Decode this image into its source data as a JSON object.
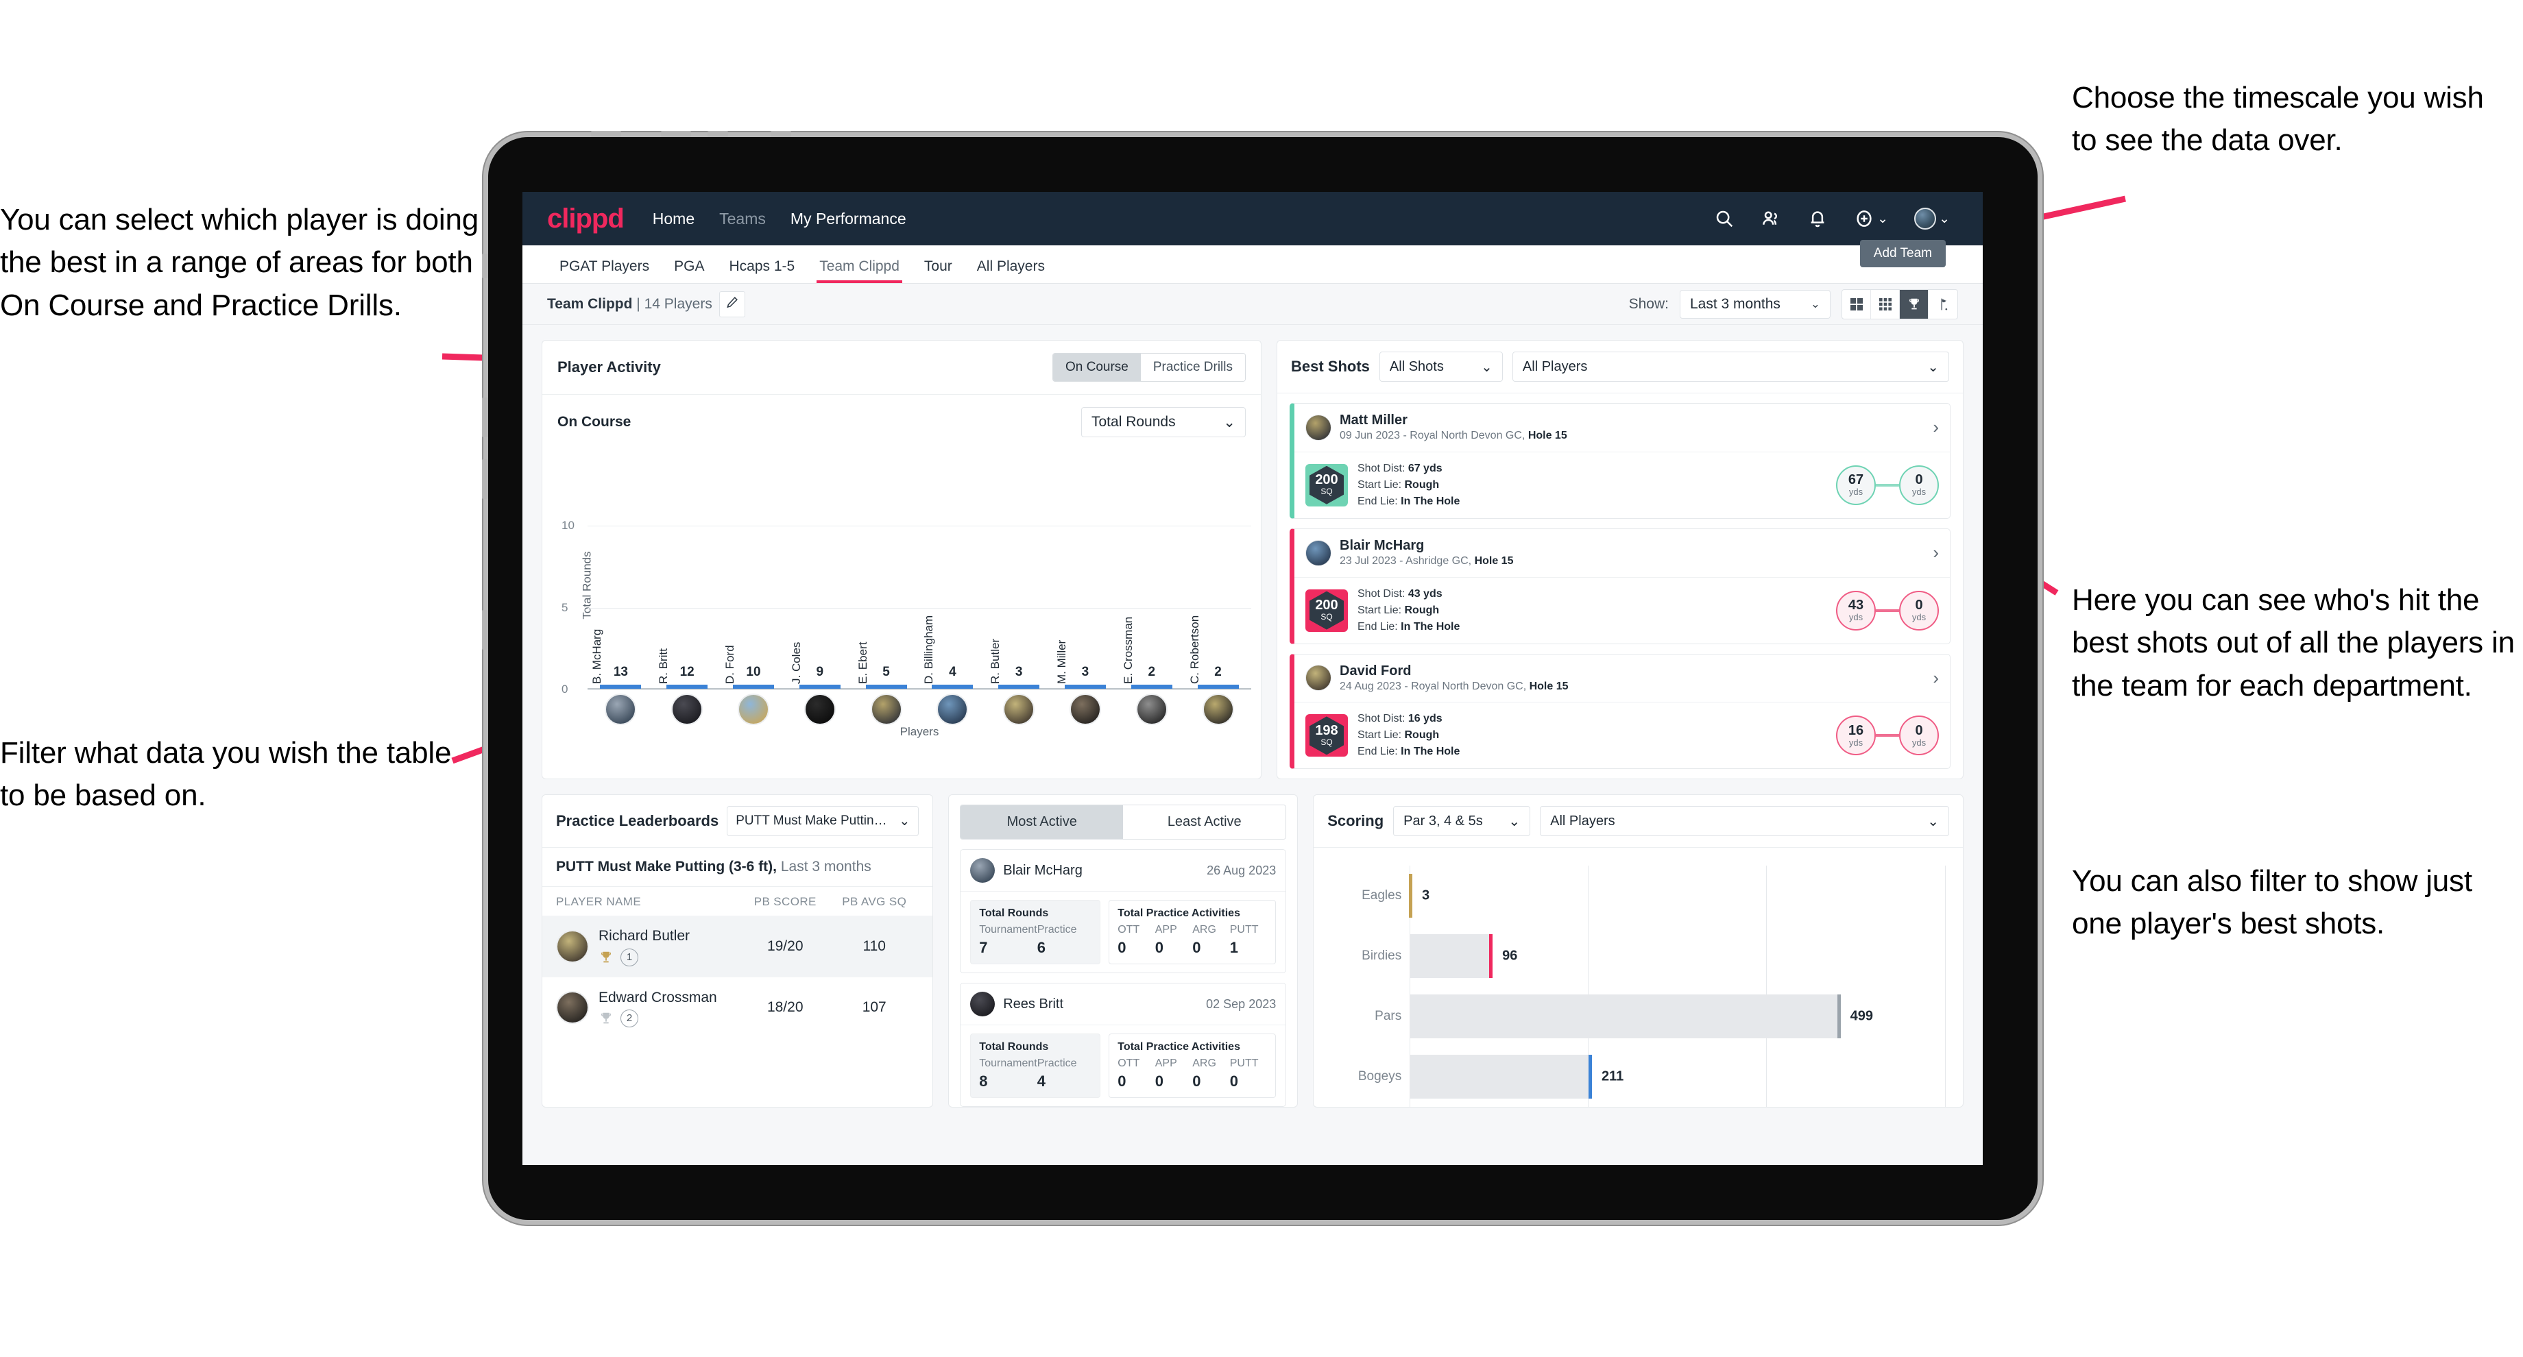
{
  "annotations": {
    "left_top": "You can select which player is doing the best in a range of areas for both On Course and Practice Drills.",
    "left_bottom": "Filter what data you wish the table to be based on.",
    "right_top": "Choose the timescale you wish to see the data over.",
    "right_middle": "Here you can see who's hit the best shots out of all the players in the team for each department.",
    "right_bottom": "You can also filter to show just one player's best shots."
  },
  "navbar": {
    "logo": "clippd",
    "links": [
      {
        "label": "Home",
        "active": true
      },
      {
        "label": "Teams",
        "active": false
      },
      {
        "label": "My Performance",
        "active": true
      }
    ],
    "icons": [
      "search-icon",
      "people-icon",
      "bell-icon",
      "plus-circle-icon",
      "avatar-icon"
    ]
  },
  "tabs": {
    "items": [
      "PGAT Players",
      "PGA",
      "Hcaps 1-5",
      "Team Clippd",
      "Tour",
      "All Players"
    ],
    "active": "Team Clippd",
    "tooltip": "Add Team"
  },
  "subheader": {
    "team_name": "Team Clippd",
    "player_count": "14 Players",
    "separator": "|",
    "edit_icon": "pencil-icon",
    "show_label": "Show:",
    "timescale": "Last 3 months",
    "view_icons": [
      "grid-large-icon",
      "grid-small-icon",
      "trophy-icon",
      "flag-icon"
    ],
    "active_view": "trophy-icon"
  },
  "player_activity": {
    "title": "Player Activity",
    "toggle": {
      "options": [
        "On Course",
        "Practice Drills"
      ],
      "selected": "On Course"
    },
    "subtitle": "On Course",
    "metric_select": "Total Rounds",
    "chart_data": {
      "type": "bar",
      "title": "On Course",
      "xlabel": "Players",
      "ylabel": "Total Rounds",
      "ylim": [
        0,
        14
      ],
      "yticks": [
        0,
        5,
        10
      ],
      "grid": true,
      "categories": [
        "B. McHarg",
        "R. Britt",
        "D. Ford",
        "J. Coles",
        "E. Ebert",
        "D. Billingham",
        "R. Butler",
        "M. Miller",
        "E. Crossman",
        "C. Robertson"
      ],
      "values": [
        13,
        12,
        10,
        9,
        5,
        4,
        3,
        3,
        2,
        2
      ]
    }
  },
  "best_shots": {
    "title": "Best Shots",
    "shot_filter": "All Shots",
    "player_filter": "All Players",
    "items": [
      {
        "player": "Matt Miller",
        "meta_date": "09 Jun 2023 - Royal North Devon GC,",
        "meta_hole": "Hole 15",
        "sq": "200",
        "sq_label": "SQ",
        "shot_dist_label": "Shot Dist:",
        "shot_dist": "67 yds",
        "start_lie_label": "Start Lie:",
        "start_lie": "Rough",
        "end_lie_label": "End Lie:",
        "end_lie": "In The Hole",
        "from_value": "67",
        "from_unit": "yds",
        "to_value": "0",
        "to_unit": "yds",
        "accent": "teal"
      },
      {
        "player": "Blair McHarg",
        "meta_date": "23 Jul 2023 - Ashridge GC,",
        "meta_hole": "Hole 15",
        "sq": "200",
        "sq_label": "SQ",
        "shot_dist_label": "Shot Dist:",
        "shot_dist": "43 yds",
        "start_lie_label": "Start Lie:",
        "start_lie": "Rough",
        "end_lie_label": "End Lie:",
        "end_lie": "In The Hole",
        "from_value": "43",
        "from_unit": "yds",
        "to_value": "0",
        "to_unit": "yds",
        "accent": "pink"
      },
      {
        "player": "David Ford",
        "meta_date": "24 Aug 2023 - Royal North Devon GC,",
        "meta_hole": "Hole 15",
        "sq": "198",
        "sq_label": "SQ",
        "shot_dist_label": "Shot Dist:",
        "shot_dist": "16 yds",
        "start_lie_label": "Start Lie:",
        "start_lie": "Rough",
        "end_lie_label": "End Lie:",
        "end_lie": "In The Hole",
        "from_value": "16",
        "from_unit": "yds",
        "to_value": "0",
        "to_unit": "yds",
        "accent": "pink"
      }
    ]
  },
  "practice_leaderboards": {
    "title": "Practice Leaderboards",
    "select": "PUTT Must Make Putting ...",
    "subtitle_bold": "PUTT Must Make Putting (3-6 ft),",
    "subtitle_light": "Last 3 months",
    "columns": [
      "PLAYER NAME",
      "PB SCORE",
      "PB AVG SQ"
    ],
    "rows": [
      {
        "name": "Richard Butler",
        "rank": "1",
        "trophy": "gold",
        "pb_score": "19/20",
        "pb_avg_sq": "110"
      },
      {
        "name": "Edward Crossman",
        "rank": "2",
        "trophy": "silver",
        "pb_score": "18/20",
        "pb_avg_sq": "107"
      }
    ]
  },
  "activity": {
    "tabs": {
      "options": [
        "Most Active",
        "Least Active"
      ],
      "selected": "Most Active"
    },
    "items": [
      {
        "name": "Blair McHarg",
        "date": "26 Aug 2023",
        "rounds_title": "Total Rounds",
        "rounds": [
          {
            "k": "Tournament",
            "v": "7"
          },
          {
            "k": "Practice",
            "v": "6"
          }
        ],
        "practice_title": "Total Practice Activities",
        "practice": [
          {
            "k": "OTT",
            "v": "0"
          },
          {
            "k": "APP",
            "v": "0"
          },
          {
            "k": "ARG",
            "v": "0"
          },
          {
            "k": "PUTT",
            "v": "1"
          }
        ]
      },
      {
        "name": "Rees Britt",
        "date": "02 Sep 2023",
        "rounds_title": "Total Rounds",
        "rounds": [
          {
            "k": "Tournament",
            "v": "8"
          },
          {
            "k": "Practice",
            "v": "4"
          }
        ],
        "practice_title": "Total Practice Activities",
        "practice": [
          {
            "k": "OTT",
            "v": "0"
          },
          {
            "k": "APP",
            "v": "0"
          },
          {
            "k": "ARG",
            "v": "0"
          },
          {
            "k": "PUTT",
            "v": "0"
          }
        ]
      }
    ]
  },
  "scoring": {
    "title": "Scoring",
    "par_filter": "Par 3, 4 & 5s",
    "player_filter": "All Players",
    "chart_data": {
      "type": "bar",
      "orientation": "horizontal",
      "title": "Scoring",
      "categories": [
        "Eagles",
        "Birdies",
        "Pars",
        "Bogeys"
      ],
      "values": [
        3,
        96,
        499,
        211
      ],
      "xlim": [
        0,
        620
      ],
      "grid": true,
      "cap_colors": [
        "#c5a253",
        "#f0285e",
        "#9aa3ab",
        "#3b82d6"
      ]
    }
  },
  "colors": {
    "brand_pink": "#f0285e",
    "nav_dark": "#1b2a3a",
    "bar_blue": "#3b82d6",
    "teal": "#6ed3b3"
  }
}
